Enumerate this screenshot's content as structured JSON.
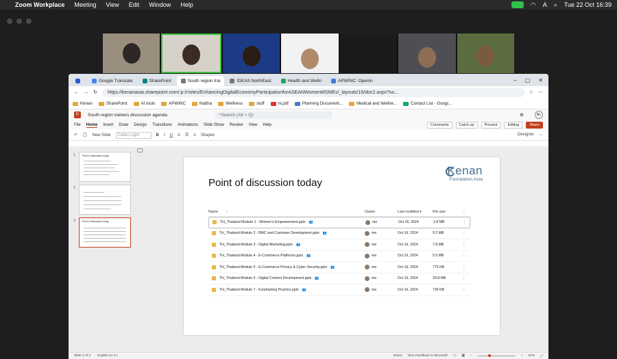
{
  "menubar": {
    "apple": "",
    "app": "Zoom Workplace",
    "items": [
      "Meeting",
      "View",
      "Edit",
      "Window",
      "Help"
    ],
    "input_lang": "A",
    "clock": "Tue 22 Oct  16:39"
  },
  "browser": {
    "tabs": [
      {
        "label": "",
        "active": false
      },
      {
        "label": "Google Translate",
        "active": false
      },
      {
        "label": "SharePoint",
        "active": false
      },
      {
        "label": "South region trai",
        "active": true
      },
      {
        "label": "IDEAS NorthEast",
        "active": false
      },
      {
        "label": "Health and Welln",
        "active": false
      },
      {
        "label": "APWINC: Openin",
        "active": false
      }
    ],
    "url": "https://kenanasia.sharepoint.com/:p:/r/sites/EnhancingDigitalEconomyParticipationforASEANWomenMSMEs/_layouts/15/doc2.aspx?so...",
    "bookmarks": [
      "Kenan",
      "SharePoint",
      "AI tools",
      "APWINC",
      "Nattha",
      "Wellness",
      "stuff",
      "ni.pdf",
      "Planning Document...",
      "Medical and Wellne...",
      "Contact List - Googl..."
    ]
  },
  "ppt": {
    "doc_title": "South region trainers discussion agenda",
    "search_placeholder": "Search (Alt + Q)",
    "user_initials": "NL",
    "ribbon_tabs": [
      "File",
      "Home",
      "Insert",
      "Draw",
      "Design",
      "Transitions",
      "Animations",
      "Slide Show",
      "Review",
      "View",
      "Help"
    ],
    "ribbon_buttons": {
      "comments": "Comments",
      "catchup": "Catch up",
      "present": "Present",
      "editing": "Editing",
      "share": "Share"
    },
    "toolbar": {
      "new_slide": "New Slide",
      "font": "Calibri Light",
      "shapes": "Shapes",
      "designer": "Designer"
    },
    "thumbnails": [
      {
        "num": "1",
        "title": "Point of discussion today"
      },
      {
        "num": "2",
        "title": ""
      },
      {
        "num": "3",
        "title": "Point of discussion today"
      }
    ],
    "status": {
      "slide": "Slide 3 of 3",
      "lang": "English (U.S.)",
      "notes": "Notes",
      "feedback": "Give Feedback to Microsoft",
      "zoom": "61%"
    }
  },
  "slide": {
    "title": "Point of discussion today",
    "logo": {
      "name": "Kenan",
      "sub": "Foundation Asia"
    },
    "columns": {
      "name": "Name",
      "owner": "Owner",
      "modified": "Last modified",
      "size": "File size"
    },
    "files": [
      {
        "name": "TH_Thailand Module 1 - Women's Empowerment.pptx",
        "owner": "me",
        "date": "Oct 16, 2024",
        "size": "2.8 MB"
      },
      {
        "name": "TH_Thailand Module 2 - BMC and Customer Development.pptx",
        "owner": "me",
        "date": "Oct 16, 2024",
        "size": "9.2 MB"
      },
      {
        "name": "TH_Thailand Module 3 - Digital Marketing.pptx",
        "owner": "me",
        "date": "Oct 16, 2024",
        "size": "7.8 MB"
      },
      {
        "name": "TH_Thailand Module 4 - E-Commerce Platforms.pptx",
        "owner": "me",
        "date": "Oct 16, 2024",
        "size": "5.5 MB"
      },
      {
        "name": "TH_Thailand Module 5 - E-Commerce Privacy & Cyber Security.pptx",
        "owner": "me",
        "date": "Oct 16, 2024",
        "size": "775 KB"
      },
      {
        "name": "TH_Thailand Module 6 - Digital Content Development.pptx",
        "owner": "me",
        "date": "Oct 16, 2024",
        "size": "29.8 MB"
      },
      {
        "name": "TH_Thailand Module 7 - Fundraising Practice.pptx",
        "owner": "me",
        "date": "Oct 16, 2024",
        "size": "739 KB"
      }
    ]
  }
}
